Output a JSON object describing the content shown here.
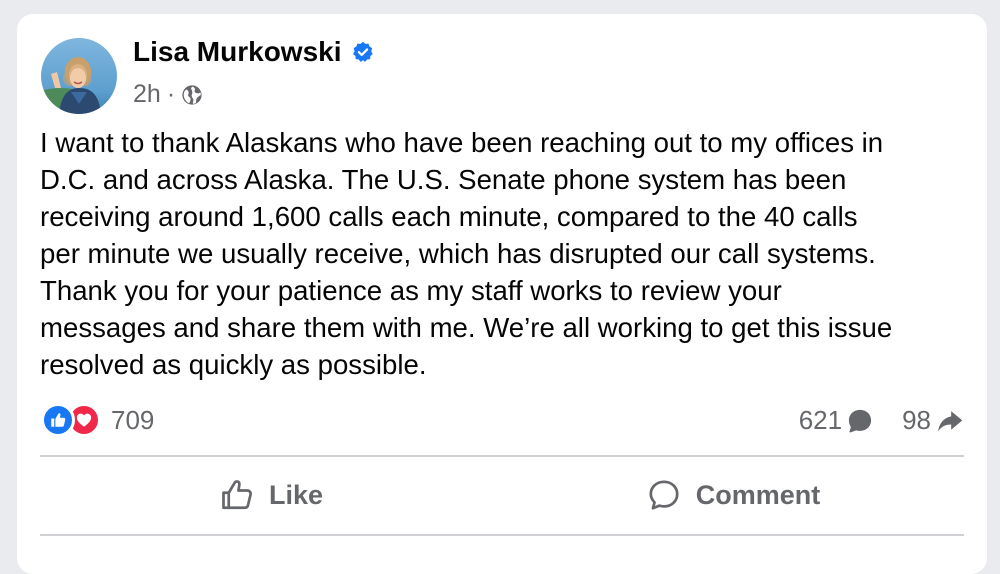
{
  "post": {
    "author": "Lisa Murkowski",
    "verified_icon": "verified-badge-icon",
    "time": "2h",
    "separator": "·",
    "audience_icon": "globe-icon",
    "text_lines": [
      "I want to thank Alaskans who have been reaching out to my offices in",
      "D.C. and across Alaska. The U.S. Senate phone system has been",
      "receiving around 1,600 calls each minute, compared to the 40 calls",
      "per minute we usually receive, which has disrupted our call systems.",
      "Thank you for your patience as my staff works to review your",
      "messages and share them with me. We’re all working to get this issue",
      "resolved as quickly as possible."
    ]
  },
  "stats": {
    "reactions": [
      "like",
      "love"
    ],
    "reaction_count": "709",
    "comments": "621",
    "shares": "98"
  },
  "actions": {
    "like_label": "Like",
    "comment_label": "Comment"
  },
  "colors": {
    "brand_blue": "#1877f2",
    "love_red": "#f0284a",
    "secondary_text": "#65676b",
    "primary_text": "#050505"
  }
}
